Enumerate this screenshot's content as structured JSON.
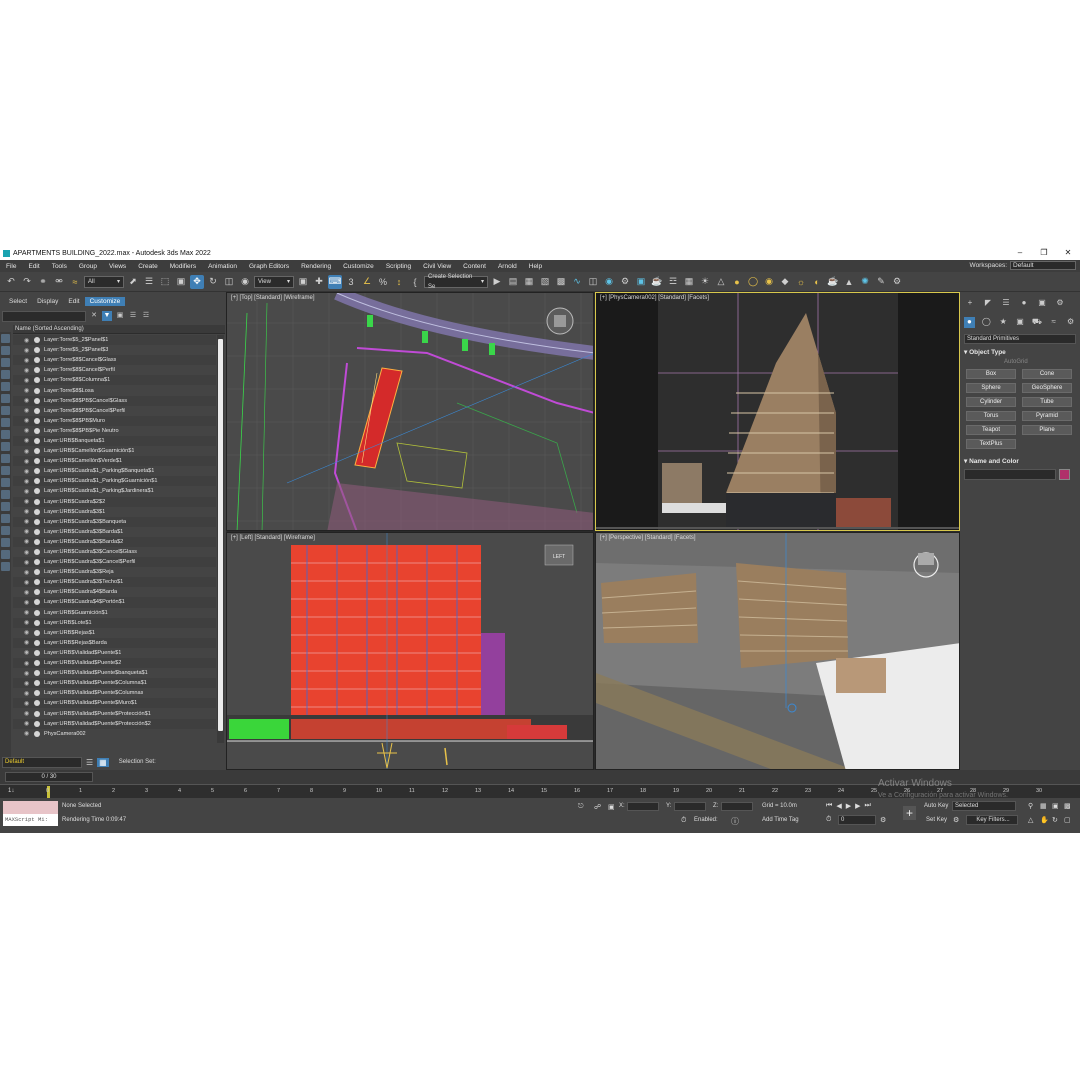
{
  "window": {
    "title": "APARTMENTS BUILDING_2022.max - Autodesk 3ds Max 2022"
  },
  "menu": {
    "items": [
      "File",
      "Edit",
      "Tools",
      "Group",
      "Views",
      "Create",
      "Modifiers",
      "Animation",
      "Graph Editors",
      "Rendering",
      "Customize",
      "Scripting",
      "Civil View",
      "Content",
      "Arnold",
      "Help"
    ],
    "workspaces_label": "Workspaces:",
    "workspaces_value": "Default"
  },
  "toolbar": {
    "selection_filter": "All",
    "ref_coord": "View",
    "create_selection_set": "Create Selection Se"
  },
  "scene_explorer": {
    "tabs": [
      "Select",
      "Display",
      "Edit",
      "Customize"
    ],
    "active_tab": "Customize",
    "column_header": "Name (Sorted Ascending)",
    "layers": [
      "Layer:Torre$5_2$Panel$1",
      "Layer:Torre$5_2$Panel$3",
      "Layer:Torre$8$Cancel$Glass",
      "Layer:Torre$8$Cancel$Perfil",
      "Layer:Torre$8$Columna$1",
      "Layer:Torre$8$Losa",
      "Layer:Torre$8$PB$Cancel$Glass",
      "Layer:Torre$8$PB$Cancel$Perfil",
      "Layer:Torre$8$PB$Muro",
      "Layer:Torre$8$PB$Pie Neutro",
      "Layer:URB$Banqueta$1",
      "Layer:URB$Camellón$Guarnición$1",
      "Layer:URB$Camellón$Verde$1",
      "Layer:URB$Cuadra$1_Parking$Banqueta$1",
      "Layer:URB$Cuadra$1_Parking$Guarnición$1",
      "Layer:URB$Cuadra$1_Parking$Jardinera$1",
      "Layer:URB$Cuadra$2$2",
      "Layer:URB$Cuadra$3$1",
      "Layer:URB$Cuadra$3$Banqueta",
      "Layer:URB$Cuadra$3$Barda$1",
      "Layer:URB$Cuadra$3$Barda$2",
      "Layer:URB$Cuadra$3$Cancel$Glass",
      "Layer:URB$Cuadra$3$Cancel$Perfil",
      "Layer:URB$Cuadra$3$Reja",
      "Layer:URB$Cuadra$3$Techo$1",
      "Layer:URB$Cuadra$4$Barda",
      "Layer:URB$Cuadra$4$Portón$1",
      "Layer:URB$Guarnición$1",
      "Layer:URB$Lote$1",
      "Layer:URB$Rejas$1",
      "Layer:URB$Rejas$Barda",
      "Layer:URB$Vialidad$Puente$1",
      "Layer:URB$Vialidad$Puente$2",
      "Layer:URB$Vialidad$Puente$banqueta$1",
      "Layer:URB$Vialidad$Puente$Columna$1",
      "Layer:URB$Vialidad$Puente$Columnas",
      "Layer:URB$Vialidad$Puente$Muro$1",
      "Layer:URB$Vialidad$Puente$Protección$1",
      "Layer:URB$Vialidad$Puente$Protección$2",
      "PhysCamera002"
    ],
    "layer_dropdown": "Default",
    "selection_set_label": "Selection Set:"
  },
  "viewports": {
    "top": "[+] [Top] [Standard] [Wireframe]",
    "camera": "[+] [PhysCamera002] [Standard] [Facets]",
    "left": "[+] [Left] [Standard] [Wireframe]",
    "perspective": "[+] [Perspective] [Standard] [Facets]",
    "viewcube_left": "LEFT"
  },
  "command_panel": {
    "category": "Standard Primitives",
    "object_type_header": "Object Type",
    "autogrid": "AutoGrid",
    "primitives": [
      "Box",
      "Cone",
      "Sphere",
      "GeoSphere",
      "Cylinder",
      "Tube",
      "Torus",
      "Pyramid",
      "Teapot",
      "Plane",
      "TextPlus"
    ],
    "name_color_header": "Name and Color",
    "color_swatch": "#b0306a"
  },
  "timeline": {
    "frame_counter": "0 / 30",
    "ticks": [
      "0",
      "1",
      "2",
      "3",
      "4",
      "5",
      "6",
      "7",
      "8",
      "9",
      "10",
      "11",
      "12",
      "13",
      "14",
      "15",
      "16",
      "17",
      "18",
      "19",
      "20",
      "21",
      "22",
      "23",
      "24",
      "25",
      "26",
      "27",
      "28",
      "29",
      "30"
    ],
    "icon_label": "1↓"
  },
  "status": {
    "maxscript": "MAXScript Mi:",
    "selection": "None Selected",
    "render_time": "Rendering Time  0:09:47",
    "x_label": "X:",
    "y_label": "Y:",
    "z_label": "Z:",
    "grid": "Grid = 10.0m",
    "enabled": "Enabled:",
    "add_time_tag": "Add Time Tag",
    "auto_key": "Auto Key",
    "selected": "Selected",
    "set_key": "Set Key",
    "key_filters": "Key Filters...",
    "frame_field": "0",
    "activate_windows": "Activar Windows",
    "activate_windows_sub": "Ve a Configuración para activar Windows."
  }
}
